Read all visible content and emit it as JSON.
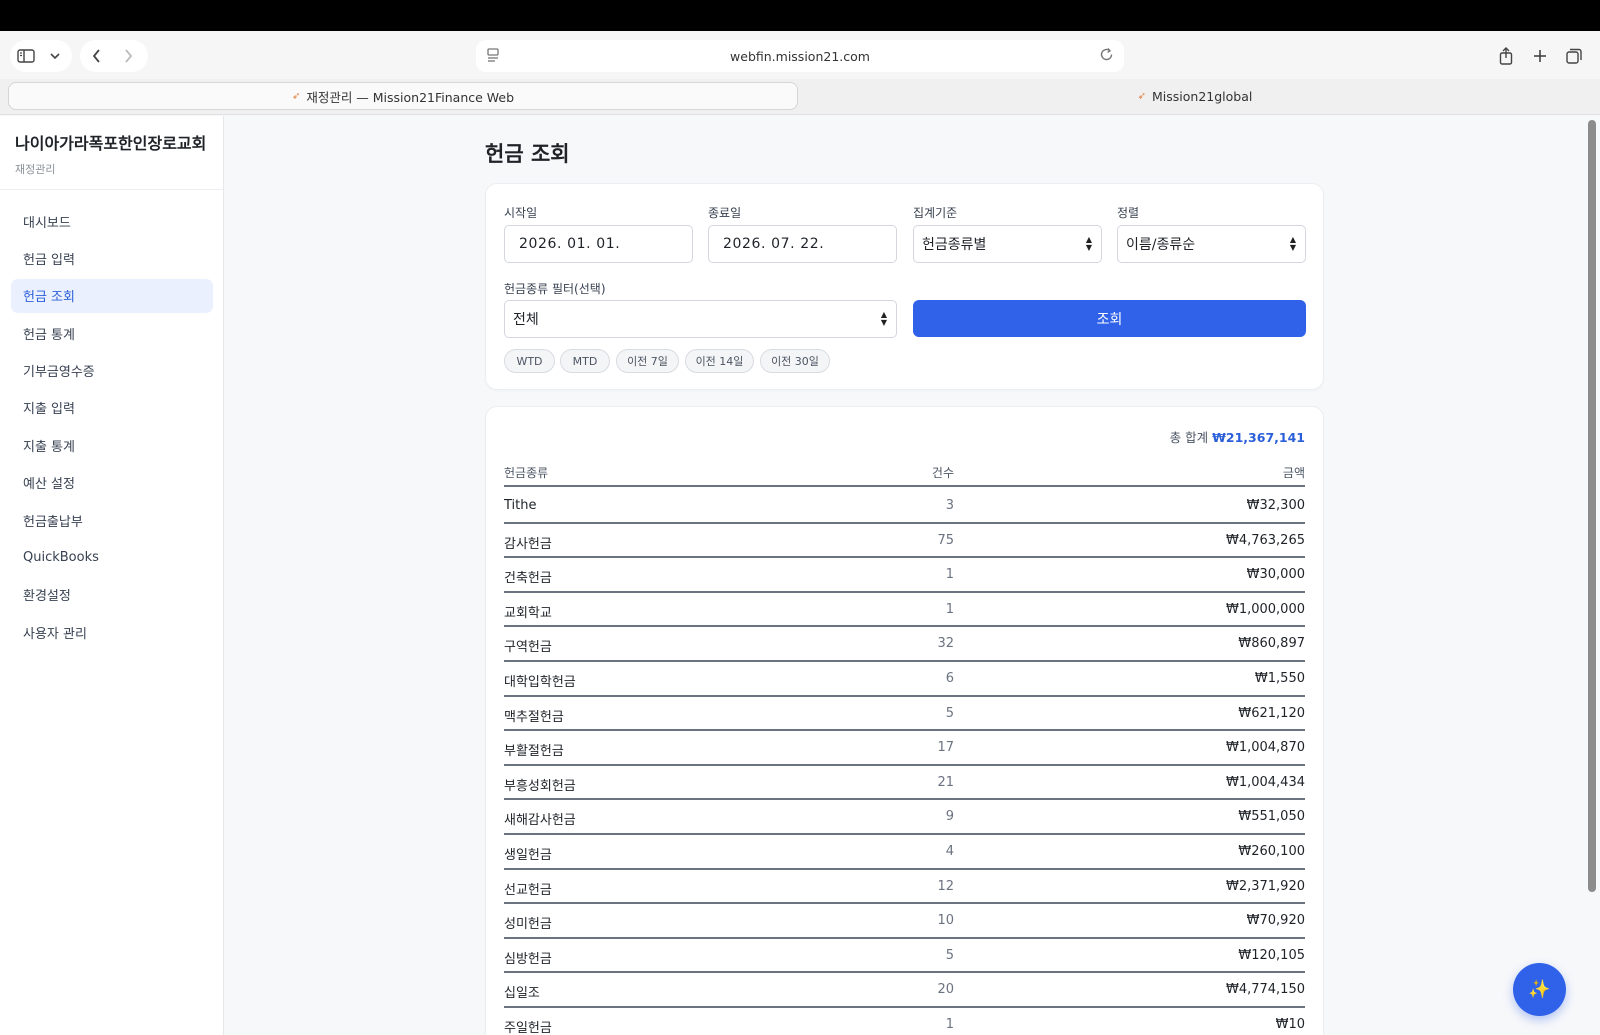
{
  "browser": {
    "url": "webfin.mission21.com",
    "tabs": [
      {
        "label": "재정관리 — Mission21Finance Web",
        "active": true
      },
      {
        "label": "Mission21global",
        "active": false
      }
    ]
  },
  "sidebar": {
    "org_name": "나이아가라폭포한인장로교회",
    "org_sub": "재정관리",
    "items": [
      {
        "label": "대시보드"
      },
      {
        "label": "헌금 입력"
      },
      {
        "label": "헌금 조회",
        "active": true
      },
      {
        "label": "헌금 통계"
      },
      {
        "label": "기부금영수증"
      },
      {
        "label": "지출 입력"
      },
      {
        "label": "지출 통계"
      },
      {
        "label": "예산 설정"
      },
      {
        "label": "헌금출납부"
      },
      {
        "label": "QuickBooks"
      },
      {
        "label": "환경설정"
      },
      {
        "label": "사용자 관리"
      }
    ]
  },
  "page": {
    "title": "헌금 조회"
  },
  "filters": {
    "start_label": "시작일",
    "start_value": "2026. 01. 01.",
    "end_label": "종료일",
    "end_value": "2026. 07. 22.",
    "group_label": "집계기준",
    "group_value": "헌금종류별",
    "sort_label": "정렬",
    "sort_value": "이름/종류순",
    "type_label": "헌금종류 필터(선택)",
    "type_value": "전체",
    "query_label": "조회",
    "chips": [
      "WTD",
      "MTD",
      "이전 7일",
      "이전 14일",
      "이전 30일"
    ]
  },
  "results": {
    "total_label": "총 합계",
    "total_value": "₩21,367,141",
    "columns": [
      "헌금종류",
      "건수",
      "금액"
    ],
    "rows": [
      {
        "name": "Tithe",
        "count": "3",
        "amount": "₩32,300"
      },
      {
        "name": "감사헌금",
        "count": "75",
        "amount": "₩4,763,265"
      },
      {
        "name": "건축헌금",
        "count": "1",
        "amount": "₩30,000"
      },
      {
        "name": "교회학교",
        "count": "1",
        "amount": "₩1,000,000"
      },
      {
        "name": "구역헌금",
        "count": "32",
        "amount": "₩860,897"
      },
      {
        "name": "대학입학헌금",
        "count": "6",
        "amount": "₩1,550"
      },
      {
        "name": "맥추절헌금",
        "count": "5",
        "amount": "₩621,120"
      },
      {
        "name": "부활절헌금",
        "count": "17",
        "amount": "₩1,004,870"
      },
      {
        "name": "부흥성회헌금",
        "count": "21",
        "amount": "₩1,004,434"
      },
      {
        "name": "새해감사헌금",
        "count": "9",
        "amount": "₩551,050"
      },
      {
        "name": "생일헌금",
        "count": "4",
        "amount": "₩260,100"
      },
      {
        "name": "선교헌금",
        "count": "12",
        "amount": "₩2,371,920"
      },
      {
        "name": "성미헌금",
        "count": "10",
        "amount": "₩70,920"
      },
      {
        "name": "심방헌금",
        "count": "5",
        "amount": "₩120,105"
      },
      {
        "name": "십일조",
        "count": "20",
        "amount": "₩4,774,150"
      },
      {
        "name": "주일헌금",
        "count": "1",
        "amount": "₩10"
      }
    ]
  },
  "colors": {
    "accent": "#2f62e9",
    "active_bg": "#eaf0fd"
  },
  "icons": {
    "fab": "sparkles-icon"
  }
}
